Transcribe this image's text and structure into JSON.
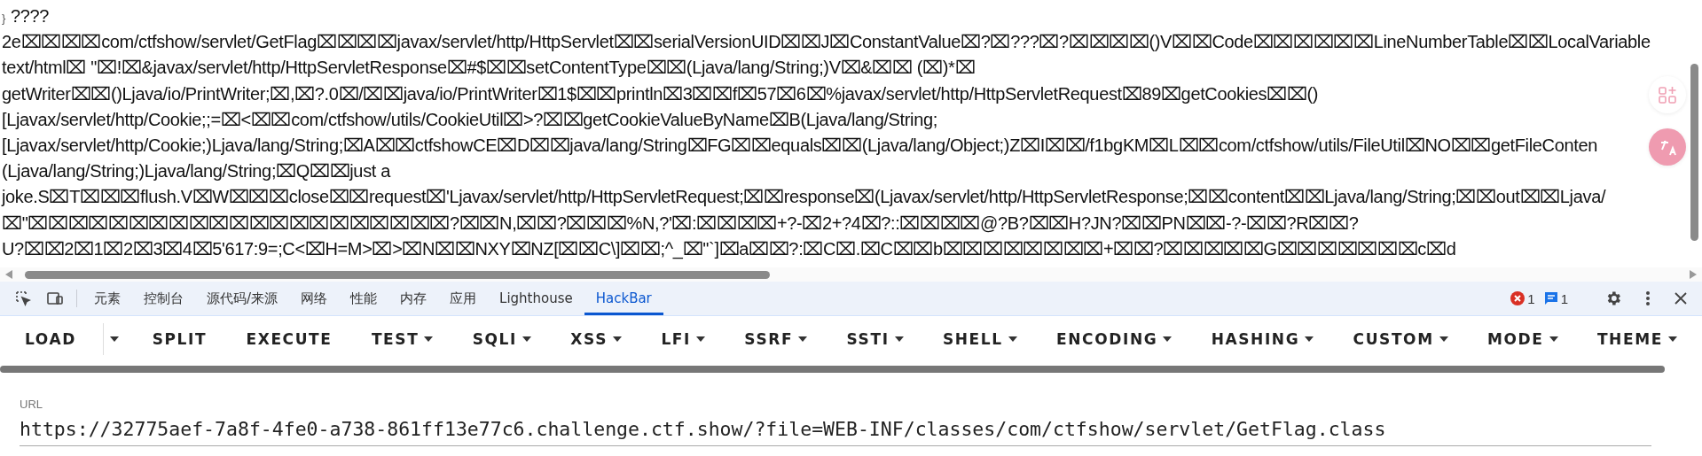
{
  "page": {
    "brace": "}",
    "lines": [
      "????",
      "2e⌧⌧⌧⌧com/ctfshow/servlet/GetFlag⌧⌧⌧⌧javax/servlet/http/HttpServlet⌧⌧serialVersionUID⌧⌧J⌧ConstantValue⌧?⌧???⌧?⌧⌧⌧⌧()V⌧⌧Code⌧⌧⌧⌧⌧⌧LineNumberTable⌧⌧LocalVariable",
      "text/html⌧ \"⌧!⌧&javax/servlet/http/HttpServletResponse⌧#$⌧⌧setContentType⌧⌧(Ljava/lang/String;)V⌧&⌧⌧ (⌧)*⌧",
      "getWriter⌧⌧()Ljava/io/PrintWriter;⌧,⌧?.0⌧/⌧⌧java/io/PrintWriter⌧1$⌧⌧println⌧3⌧⌧f⌧57⌧6⌧%javax/servlet/http/HttpServletRequest⌧89⌧getCookies⌧⌧()",
      "[Ljavax/servlet/http/Cookie;;=⌧<⌧⌧com/ctfshow/utils/CookieUtil⌧>?⌧⌧getCookieValueByName⌧B(Ljava/lang/String;",
      "[Ljavax/servlet/http/Cookie;)Ljava/lang/String;⌧A⌧⌧ctfshowCE⌧D⌧⌧java/lang/String⌧FG⌧⌧equals⌧⌧(Ljava/lang/Object;)Z⌧I⌧⌧/f1bgKM⌧L⌧⌧com/ctfshow/utils/FileUtil⌧NO⌧⌧getFileConten",
      "(Ljava/lang/String;)Ljava/lang/String;⌧Q⌧⌧just a",
      "joke.S⌧T⌧⌧⌧flush.V⌧W⌧⌧⌧close⌧⌧request⌧'Ljavax/servlet/http/HttpServletRequest;⌧⌧response⌧(Ljavax/servlet/http/HttpServletResponse;⌧⌧content⌧⌧Ljava/lang/String;⌧⌧out⌧⌧Ljava/",
      "⌧\"⌧⌧⌧⌧⌧⌧⌧⌧⌧⌧⌧⌧⌧⌧⌧⌧⌧⌧⌧⌧⌧?⌧⌧N,⌧⌧?⌧⌧⌧%N,?'⌧:⌧⌧⌧⌧+?-⌧2+?4⌧?::⌧⌧⌧⌧@?B?⌧⌧H?JN?⌧⌧PN⌧⌧-?-⌧⌧?R⌧⌧?",
      "U?⌧⌧2⌧1⌧2⌧3⌧4⌧5'617:9=;C<⌧H=M>⌧>⌧N⌧⌧NXY⌧NZ[⌧⌧C\\]⌧⌧;^_⌧''`]⌧a⌧⌧?:⌧C⌧.⌧C⌧⌧b⌧⌧⌧⌧⌧⌧⌧⌧+⌧⌧?⌧⌧⌧⌧⌧G⌧⌧⌧⌧⌧⌧⌧c⌧d"
    ]
  },
  "devtools": {
    "tabs": [
      {
        "label": "元素",
        "selected": false
      },
      {
        "label": "控制台",
        "selected": false
      },
      {
        "label": "源代码/来源",
        "selected": false
      },
      {
        "label": "网络",
        "selected": false
      },
      {
        "label": "性能",
        "selected": false
      },
      {
        "label": "内存",
        "selected": false
      },
      {
        "label": "应用",
        "selected": false
      },
      {
        "label": "Lighthouse",
        "selected": false
      },
      {
        "label": "HackBar",
        "selected": true
      }
    ],
    "errors": "1",
    "messages": "1"
  },
  "hackbar": {
    "buttons": [
      {
        "label": "LOAD",
        "kind": "split"
      },
      {
        "label": "SPLIT",
        "kind": "plain"
      },
      {
        "label": "EXECUTE",
        "kind": "plain"
      },
      {
        "label": "TEST",
        "kind": "menu"
      },
      {
        "label": "SQLI",
        "kind": "menu"
      },
      {
        "label": "XSS",
        "kind": "menu"
      },
      {
        "label": "LFI",
        "kind": "menu"
      },
      {
        "label": "SSRF",
        "kind": "menu"
      },
      {
        "label": "SSTI",
        "kind": "menu"
      },
      {
        "label": "SHELL",
        "kind": "menu"
      },
      {
        "label": "ENCODING",
        "kind": "menu"
      },
      {
        "label": "HASHING",
        "kind": "menu"
      },
      {
        "label": "CUSTOM",
        "kind": "menu"
      },
      {
        "label": "MODE",
        "kind": "menu"
      },
      {
        "label": "THEME",
        "kind": "menu"
      }
    ],
    "url": {
      "label": "URL",
      "value": "https://32775aef-7a8f-4fe0-a738-861ff13e77c6.challenge.ctf.show/?file=WEB-INF/classes/com/ctfshow/servlet/GetFlag.class"
    }
  }
}
